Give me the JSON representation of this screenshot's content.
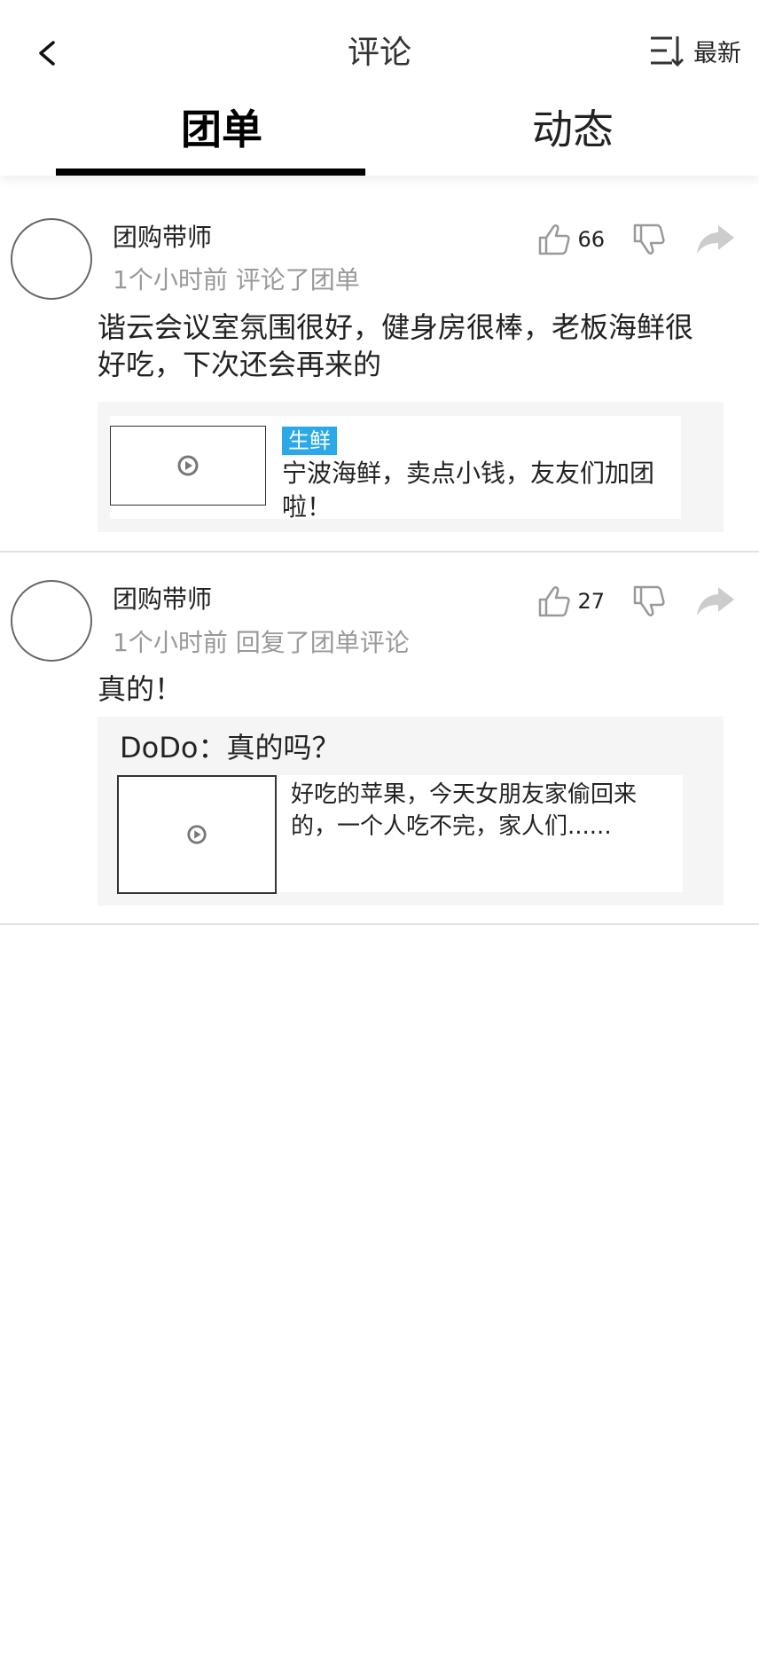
{
  "header": {
    "title": "评论",
    "sort_label": "最新"
  },
  "tabs": [
    {
      "label": "团单",
      "active": true
    },
    {
      "label": "动态",
      "active": false
    }
  ],
  "comments": [
    {
      "username": "团购带师",
      "meta": "1个小时前 评论了团单",
      "likes": "66",
      "text": "谐云会议室氛围很好，健身房很棒，老板海鲜很好吃，下次还会再来的",
      "card": {
        "tag": "生鲜",
        "text": "宁波海鲜，卖点小钱，友友们加团啦！"
      }
    },
    {
      "username": "团购带师",
      "meta": "1个小时前 回复了团单评论",
      "likes": "27",
      "text": "真的！",
      "quote": "DoDo：真的吗？",
      "card": {
        "text": "好吃的苹果，今天女朋友家偷回来的，一个人吃不完，家人们......"
      }
    }
  ],
  "colors": {
    "tag_bg": "#2ba8e8",
    "meta_text": "#999999",
    "card_bg": "#f5f5f5"
  },
  "icons": [
    "back-icon",
    "sort-icon",
    "thumbs-up-icon",
    "thumbs-down-icon",
    "share-icon",
    "play-icon"
  ]
}
